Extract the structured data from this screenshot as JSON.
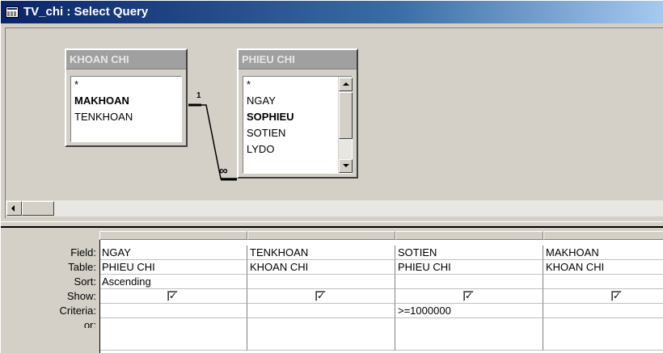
{
  "window": {
    "title": "TV_chi : Select Query",
    "icon": "query-icon"
  },
  "field_lists": [
    {
      "title": "KHOAN CHI",
      "fields": [
        {
          "name": "*",
          "bold": false
        },
        {
          "name": "MAKHOAN",
          "bold": true
        },
        {
          "name": "TENKHOAN",
          "bold": false
        }
      ]
    },
    {
      "title": "PHIEU CHI",
      "fields": [
        {
          "name": "*",
          "bold": false
        },
        {
          "name": "NGAY",
          "bold": false
        },
        {
          "name": "SOPHIEU",
          "bold": true
        },
        {
          "name": "SOTIEN",
          "bold": false
        },
        {
          "name": "LYDO",
          "bold": false
        }
      ]
    }
  ],
  "relationship": {
    "one_side": "1",
    "many_side": "∞"
  },
  "grid": {
    "row_labels": [
      "Field:",
      "Table:",
      "Sort:",
      "Show:",
      "Criteria:",
      "or:"
    ],
    "columns": [
      {
        "field": "NGAY",
        "table": "PHIEU CHI",
        "sort": "Ascending",
        "show": true,
        "criteria": ""
      },
      {
        "field": "TENKHOAN",
        "table": "KHOAN CHI",
        "sort": "",
        "show": true,
        "criteria": ""
      },
      {
        "field": "SOTIEN",
        "table": "PHIEU CHI",
        "sort": "",
        "show": true,
        "criteria": ">=1000000"
      },
      {
        "field": "MAKHOAN",
        "table": "KHOAN CHI",
        "sort": "",
        "show": true,
        "criteria": ""
      }
    ]
  },
  "icons": {
    "checkbox": "checkmark-icon",
    "scroll_up": "arrow-up-icon",
    "scroll_down": "arrow-down-icon",
    "scroll_left": "arrow-left-icon"
  }
}
